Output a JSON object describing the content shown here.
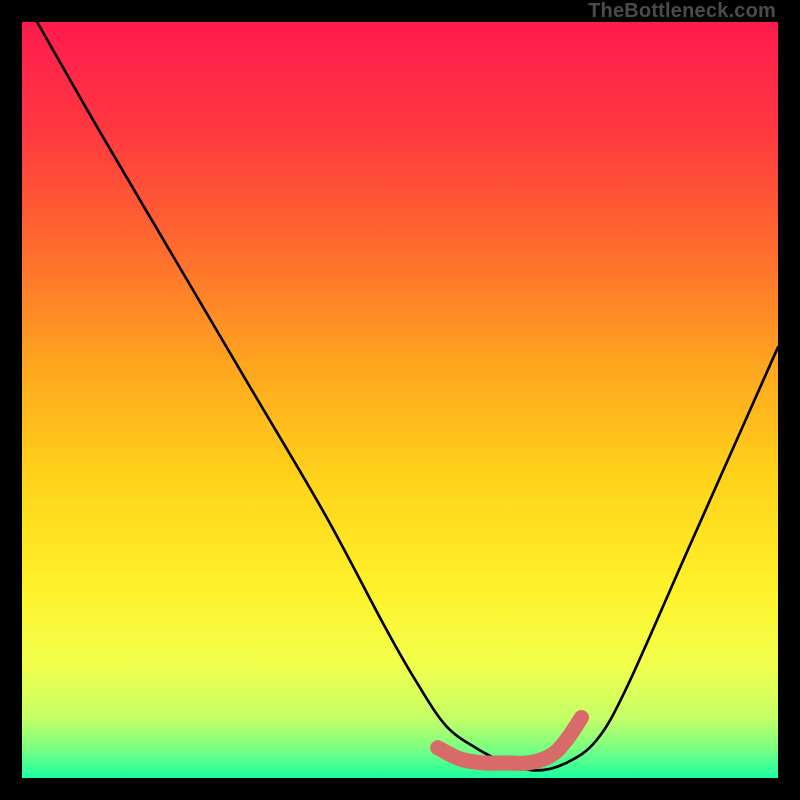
{
  "watermark": "TheBottleneck.com",
  "chart_data": {
    "type": "line",
    "title": "",
    "xlabel": "",
    "ylabel": "",
    "xlim": [
      0,
      100
    ],
    "ylim": [
      0,
      100
    ],
    "grid": false,
    "legend": false,
    "annotations": [],
    "series": [
      {
        "name": "curve",
        "color": "#000000",
        "x": [
          2,
          10,
          20,
          30,
          40,
          48,
          52,
          56,
          60,
          64,
          68,
          72,
          76,
          80,
          88,
          96,
          100
        ],
        "y": [
          100,
          86,
          69,
          52,
          35,
          20,
          13,
          7,
          4,
          2,
          1,
          2,
          5,
          12,
          30,
          48,
          57
        ]
      },
      {
        "name": "highlight",
        "color": "#d96a6a",
        "x": [
          55,
          58,
          61,
          64,
          67,
          70,
          72,
          74
        ],
        "y": [
          4,
          2.5,
          2,
          2,
          2,
          3,
          5,
          8
        ]
      }
    ],
    "background_gradient_stops": [
      {
        "offset": 0.0,
        "color": "#ff1a4e"
      },
      {
        "offset": 0.15,
        "color": "#ff3a3f"
      },
      {
        "offset": 0.3,
        "color": "#ff6b2e"
      },
      {
        "offset": 0.45,
        "color": "#ffa41f"
      },
      {
        "offset": 0.6,
        "color": "#ffd21a"
      },
      {
        "offset": 0.75,
        "color": "#fff22a"
      },
      {
        "offset": 0.85,
        "color": "#f2ff4d"
      },
      {
        "offset": 0.92,
        "color": "#c6ff66"
      },
      {
        "offset": 0.96,
        "color": "#7cff80"
      },
      {
        "offset": 1.0,
        "color": "#1aff9e"
      }
    ]
  }
}
